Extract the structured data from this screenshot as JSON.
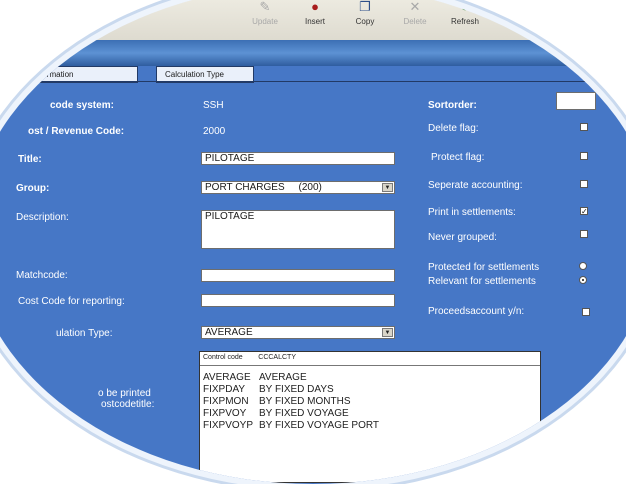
{
  "toolbar": {
    "buttons": [
      {
        "label": "Update",
        "icon": "update-icon",
        "enabled": false
      },
      {
        "label": "Insert",
        "icon": "insert-icon",
        "enabled": true
      },
      {
        "label": "Copy",
        "icon": "copy-icon",
        "enabled": true
      },
      {
        "label": "Delete",
        "icon": "delete-icon",
        "enabled": false
      },
      {
        "label": "Refresh",
        "icon": "refresh-icon",
        "enabled": true
      }
    ]
  },
  "tabs": [
    {
      "label": "ubinformation",
      "active": false
    },
    {
      "label": "Calculation Type",
      "active": true
    }
  ],
  "form": {
    "code_system": {
      "label": "code system:",
      "value": "SSH"
    },
    "cost_revenue_code": {
      "label": "ost / Revenue Code:",
      "value": "2000"
    },
    "title": {
      "label": "Title:",
      "value": "PILOTAGE"
    },
    "group": {
      "label": "Group:",
      "value": "PORT CHARGES     (200)"
    },
    "description": {
      "label": "Description:",
      "value": "PILOTAGE"
    },
    "matchcode": {
      "label": "Matchcode:",
      "value": ""
    },
    "cost_code_reporting": {
      "label": "Cost Code for reporting:",
      "value": ""
    },
    "calculation_type": {
      "label": "ulation Type:",
      "value": "AVERAGE"
    },
    "printed_title": {
      "line1": "o be printed",
      "line2": "ostcodetitle:"
    }
  },
  "right_panel": {
    "sortorder_label": "Sortorder:",
    "sortorder_value": "",
    "flags": [
      {
        "label": "Delete flag:",
        "checked": false
      },
      {
        "label": "Protect flag:",
        "checked": false
      },
      {
        "label": "Seperate accounting:",
        "checked": false
      },
      {
        "label": "Print in settlements:",
        "checked": true
      },
      {
        "label": "Never grouped:",
        "checked": false
      }
    ],
    "radios": [
      {
        "label": "Protected for settlements",
        "selected": false
      },
      {
        "label": "Relevant for settlements",
        "selected": true
      }
    ],
    "proceeds_label": "Proceedsaccount y/n:",
    "proceeds_checked": false
  },
  "calc_dropdown": {
    "header": {
      "code": "Control code",
      "name": "CCCALCTY"
    },
    "options": [
      {
        "code": "AVERAGE",
        "name": "AVERAGE"
      },
      {
        "code": "FIXPDAY",
        "name": "BY FIXED DAYS"
      },
      {
        "code": "FIXPMON",
        "name": "BY FIXED MONTHS"
      },
      {
        "code": "FIXPVOY",
        "name": "BY FIXED VOYAGE"
      },
      {
        "code": "FIXPVOYP",
        "name": "BY FIXED VOYAGE PORT"
      }
    ]
  },
  "colors": {
    "panel": "#4677c6",
    "banner": "#3c6fb4",
    "toolbar": "#e8e5da"
  }
}
